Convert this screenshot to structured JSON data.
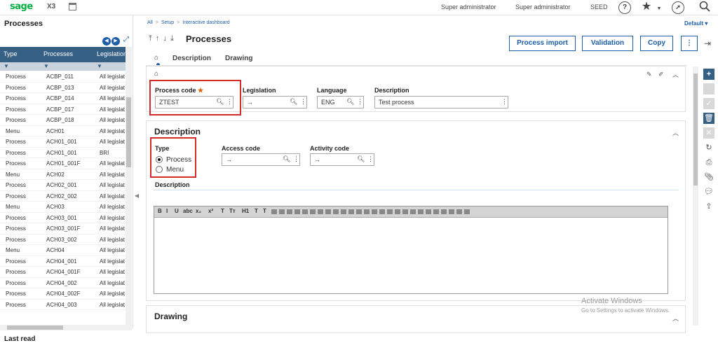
{
  "topbar": {
    "logo": "sage",
    "product": "X3",
    "user1": "Super administrator",
    "user2": "Super administrator",
    "folder": "SEED",
    "help_icon": "?"
  },
  "left_panel": {
    "title": "Processes",
    "columns": [
      "Type",
      "Processes",
      "Legislation"
    ],
    "rows": [
      [
        "Process",
        "ACBP_011",
        "All legislat"
      ],
      [
        "Process",
        "ACBP_013",
        "All legislat"
      ],
      [
        "Process",
        "ACBP_014",
        "All legislat"
      ],
      [
        "Process",
        "ACBP_017",
        "All legislat"
      ],
      [
        "Process",
        "ACBP_018",
        "All legislat"
      ],
      [
        "Menu",
        "ACH01",
        "All legislat"
      ],
      [
        "Process",
        "ACH01_001",
        "All legislat"
      ],
      [
        "Process",
        "ACH01_001",
        "BRI"
      ],
      [
        "Process",
        "ACH01_001F",
        "All legislat"
      ],
      [
        "Menu",
        "ACH02",
        "All legislat"
      ],
      [
        "Process",
        "ACH02_001",
        "All legislat"
      ],
      [
        "Process",
        "ACH02_002",
        "All legislat"
      ],
      [
        "Menu",
        "ACH03",
        "All legislat"
      ],
      [
        "Process",
        "ACH03_001",
        "All legislat"
      ],
      [
        "Process",
        "ACH03_001F",
        "All legislat"
      ],
      [
        "Process",
        "ACH03_002",
        "All legislat"
      ],
      [
        "Menu",
        "ACH04",
        "All legislat"
      ],
      [
        "Process",
        "ACH04_001",
        "All legislat"
      ],
      [
        "Process",
        "ACH04_001F",
        "All legislat"
      ],
      [
        "Process",
        "ACH04_002",
        "All legislat"
      ],
      [
        "Process",
        "ACH04_002F",
        "All legislat"
      ],
      [
        "Process",
        "ACH04_003",
        "All legislat"
      ]
    ],
    "last_read": "Last read"
  },
  "breadcrumb": [
    "All",
    "Setup",
    "Interactive dashboard"
  ],
  "default_label": "Default",
  "page": {
    "title": "Processes",
    "buttons": {
      "import": "Process import",
      "validation": "Validation",
      "copy": "Copy",
      "more": "⋮"
    }
  },
  "tabs": [
    "Description",
    "Drawing"
  ],
  "header_section": {
    "process_code_label": "Process code",
    "required_mark": "★",
    "process_code_value": "ZTEST",
    "legislation_label": "Legislation",
    "legislation_value": "→",
    "language_label": "Language",
    "language_value": "ENG",
    "description_label": "Description",
    "description_value": "Test process"
  },
  "description_section": {
    "title": "Description",
    "type_label": "Type",
    "type_options": [
      "Process",
      "Menu"
    ],
    "type_selected": "Process",
    "access_code_label": "Access code",
    "access_code_value": "→",
    "activity_code_label": "Activity code",
    "activity_code_value": "→",
    "description_label": "Description",
    "toolbar": [
      "B",
      "I",
      "U",
      "abc",
      "x₂",
      "x²",
      "T",
      "Tт",
      "H1",
      "T",
      "T"
    ]
  },
  "drawing_section": {
    "title": "Drawing"
  },
  "watermark": {
    "line1": "Activate Windows",
    "line2": "Go to Settings to activate Windows."
  }
}
